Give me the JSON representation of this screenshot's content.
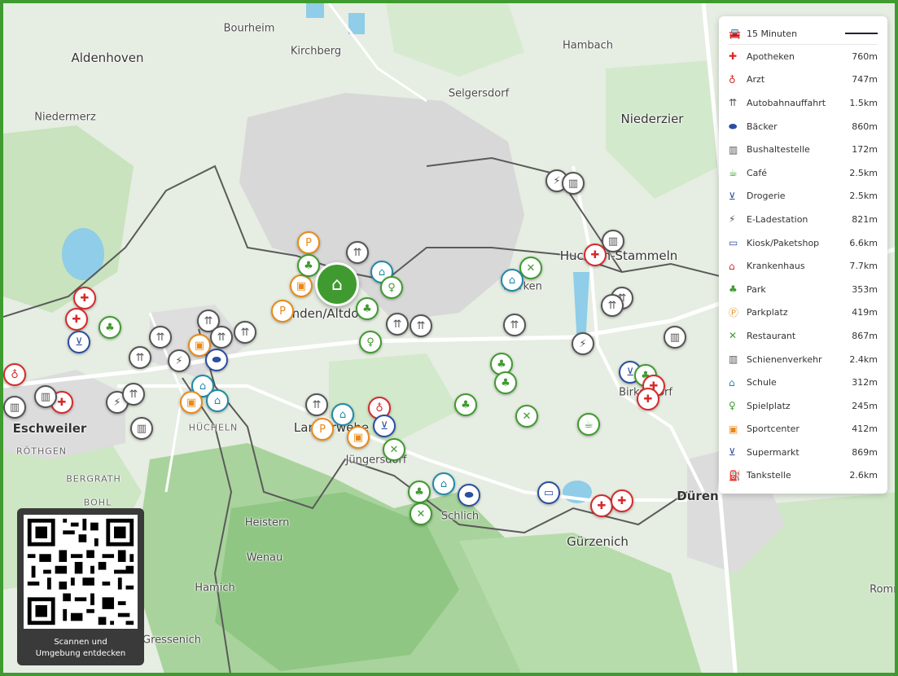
{
  "places": [
    {
      "name": "Aldenhoven",
      "kind": "big"
    },
    {
      "name": "Bourheim",
      "kind": "normal"
    },
    {
      "name": "Kirchberg",
      "kind": "normal"
    },
    {
      "name": "Hambach",
      "kind": "normal"
    },
    {
      "name": "Selgersdorf",
      "kind": "normal"
    },
    {
      "name": "Niedermerz",
      "kind": "normal"
    },
    {
      "name": "Niederzier",
      "kind": "big"
    },
    {
      "name": "Huchem-Stammeln",
      "kind": "big"
    },
    {
      "name": "Merken",
      "kind": "normal"
    },
    {
      "name": "Inden/Altdorf",
      "kind": "big"
    },
    {
      "name": "Birkesdorf",
      "kind": "normal"
    },
    {
      "name": "Eschweiler",
      "kind": "bold"
    },
    {
      "name": "RÖTHGEN",
      "kind": "small"
    },
    {
      "name": "HÜCHELN",
      "kind": "small"
    },
    {
      "name": "BERGRATH",
      "kind": "small"
    },
    {
      "name": "BOHL",
      "kind": "small"
    },
    {
      "name": "Langerwehe",
      "kind": "big"
    },
    {
      "name": "Jüngersdorf",
      "kind": "normal"
    },
    {
      "name": "Schlich",
      "kind": "normal"
    },
    {
      "name": "Düren",
      "kind": "bold"
    },
    {
      "name": "Gürzenich",
      "kind": "big"
    },
    {
      "name": "Heistern",
      "kind": "normal"
    },
    {
      "name": "Wenau",
      "kind": "normal"
    },
    {
      "name": "Hamich",
      "kind": "normal"
    },
    {
      "name": "Gressenich",
      "kind": "normal"
    },
    {
      "name": "Romm",
      "kind": "normal"
    }
  ],
  "legend": {
    "travel_time": "15 Minuten",
    "travel_icon": "car-icon",
    "items": [
      {
        "label": "Apotheken",
        "distance": "760m",
        "icon": "pharmacy-icon",
        "color": "#d62a2a"
      },
      {
        "label": "Arzt",
        "distance": "747m",
        "icon": "stethoscope-icon",
        "color": "#d62a2a"
      },
      {
        "label": "Autobahnauffahrt",
        "distance": "1.5km",
        "icon": "highway-icon",
        "color": "#555555"
      },
      {
        "label": "Bäcker",
        "distance": "860m",
        "icon": "bread-icon",
        "color": "#2b4ea0"
      },
      {
        "label": "Bushaltestelle",
        "distance": "172m",
        "icon": "bus-icon",
        "color": "#555555"
      },
      {
        "label": "Café",
        "distance": "2.5km",
        "icon": "coffee-icon",
        "color": "#3f9b2f"
      },
      {
        "label": "Drogerie",
        "distance": "2.5km",
        "icon": "cart-icon",
        "color": "#2b4ea0"
      },
      {
        "label": "E-Ladestation",
        "distance": "821m",
        "icon": "ev-charger-icon",
        "color": "#555555"
      },
      {
        "label": "Kiosk/Paketshop",
        "distance": "6.6km",
        "icon": "shop-icon",
        "color": "#2b4ea0"
      },
      {
        "label": "Krankenhaus",
        "distance": "7.7km",
        "icon": "hospital-icon",
        "color": "#d62a2a"
      },
      {
        "label": "Park",
        "distance": "353m",
        "icon": "tree-icon",
        "color": "#3f9b2f"
      },
      {
        "label": "Parkplatz",
        "distance": "419m",
        "icon": "parking-icon",
        "color": "#e88a1a"
      },
      {
        "label": "Restaurant",
        "distance": "867m",
        "icon": "cutlery-icon",
        "color": "#3f9b2f"
      },
      {
        "label": "Schienenverkehr",
        "distance": "2.4km",
        "icon": "train-icon",
        "color": "#555555"
      },
      {
        "label": "Schule",
        "distance": "312m",
        "icon": "school-icon",
        "color": "#1f8aa6"
      },
      {
        "label": "Spielplatz",
        "distance": "245m",
        "icon": "playground-icon",
        "color": "#3f9b2f"
      },
      {
        "label": "Sportcenter",
        "distance": "412m",
        "icon": "sports-icon",
        "color": "#e88a1a"
      },
      {
        "label": "Supermarkt",
        "distance": "869m",
        "icon": "supermarket-icon",
        "color": "#2b4ea0"
      },
      {
        "label": "Tankstelle",
        "distance": "2.6km",
        "icon": "fuel-icon",
        "color": "#555555"
      }
    ]
  },
  "qr": {
    "caption_line1": "Scannen und",
    "caption_line2": "Umgebung entdecken"
  },
  "colors": {
    "frame": "#3f9b2f",
    "home_marker": "#3f9b2f"
  }
}
